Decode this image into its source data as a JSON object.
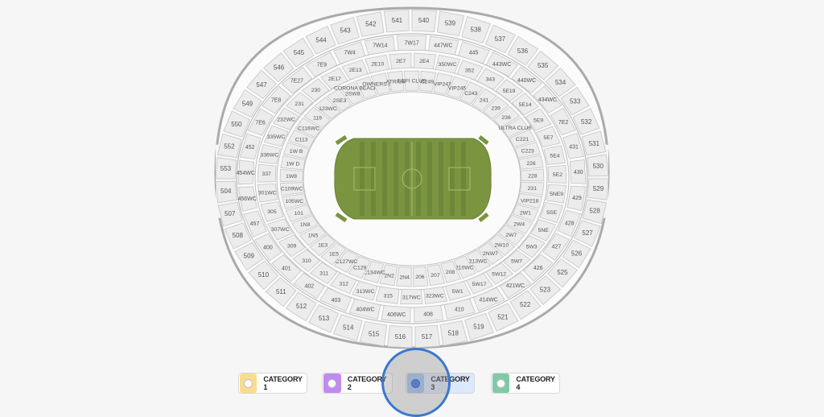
{
  "venue": {
    "field_color": "#7a9440",
    "section_fill": "#ececec",
    "section_stroke": "#c4c4c4"
  },
  "sections": {
    "upper": [
      "540",
      "539",
      "538",
      "537",
      "536",
      "535",
      "534",
      "533",
      "532",
      "531",
      "530",
      "529",
      "528",
      "527",
      "526",
      "525",
      "523",
      "522",
      "521",
      "519",
      "518",
      "517",
      "516",
      "515",
      "514",
      "513",
      "512",
      "511",
      "510",
      "509",
      "508",
      "507",
      "504",
      "553",
      "552",
      "550",
      "549",
      "547",
      "546",
      "545",
      "544",
      "543",
      "542",
      "541"
    ],
    "gates": [
      "447WC",
      "445",
      "443WC",
      "440WC",
      "434WC",
      "7E2",
      "431",
      "430",
      "429",
      "428",
      "427",
      "426",
      "421WC",
      "414WC",
      "410",
      "408",
      "406WC",
      "404WC",
      "403",
      "402",
      "401",
      "400",
      "457",
      "456WC",
      "454WC",
      "452",
      "7E6",
      "7E8",
      "7E27",
      "7E9",
      "7W4",
      "7W14",
      "7W17"
    ],
    "mid_east": [
      "350WC",
      "352",
      "343",
      "5E19",
      "5E14",
      "5E9",
      "5E7",
      "5E4",
      "5E2",
      "5NE9",
      "5SE",
      "5NE",
      "5W3",
      "5W7",
      "5W12",
      "5W17",
      "5W1",
      "323WC",
      "317WC",
      "315",
      "313WC",
      "312",
      "311",
      "310",
      "309",
      "307WC",
      "305",
      "301WC",
      "337",
      "336WC",
      "335WC",
      "232WC",
      "231",
      "230",
      "2E17",
      "2E13",
      "2E10",
      "2E7",
      "2E4"
    ],
    "lower": [
      "C249",
      "VIP247",
      "VIP245",
      "C243",
      "241",
      "239",
      "236",
      "ULTRA CLUB",
      "C221",
      "C223",
      "226",
      "228",
      "231",
      "VIP218",
      "2W1",
      "2W4",
      "2W7",
      "2W10",
      "2NW7",
      "213WC",
      "210WC",
      "208",
      "207",
      "206",
      "2N4",
      "2N2",
      "C134WC",
      "C129",
      "C127WC",
      "1E5",
      "1E3",
      "1N5",
      "1N8",
      "101",
      "105WC",
      "C109WC",
      "1W8",
      "1W D",
      "1W B",
      "C113",
      "C116WC",
      "119",
      "123WC",
      "2SE3",
      "2SW8",
      "CORONA BEACH HOUSE",
      "OWNERS BOX",
      "ATRIUM",
      "SOFI CLUB"
    ]
  },
  "legend": [
    {
      "label": "CATEGORY 1",
      "swatch": "#fbdc8e"
    },
    {
      "label": "CATEGORY 2",
      "swatch": "#c08af0"
    },
    {
      "label": "CATEGORY 3",
      "swatch": "#2f6fe8",
      "selected": true
    },
    {
      "label": "CATEGORY 4",
      "swatch": "#7fcaa5"
    }
  ]
}
